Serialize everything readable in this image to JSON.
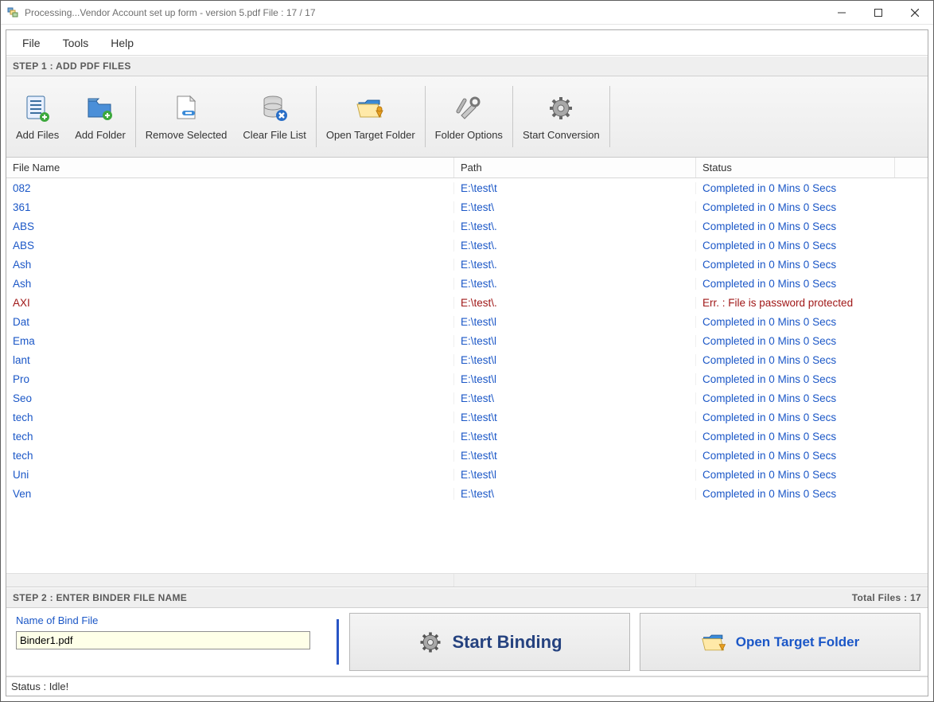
{
  "window": {
    "title": "Processing...Vendor Account set up form - version 5.pdf File : 17 / 17"
  },
  "menu": {
    "file": "File",
    "tools": "Tools",
    "help": "Help"
  },
  "step1": {
    "header": "STEP 1 : ADD PDF FILES"
  },
  "toolbar": {
    "add_files": "Add Files",
    "add_folder": "Add Folder",
    "remove_selected": "Remove Selected",
    "clear_list": "Clear File List",
    "open_target": "Open Target Folder",
    "folder_options": "Folder Options",
    "start_conversion": "Start Conversion"
  },
  "grid": {
    "headers": {
      "name": "File Name",
      "path": "Path",
      "status": "Status"
    },
    "rows": [
      {
        "name": "082",
        "path": "E:\\test\\t",
        "status": "Completed in 0 Mins 0 Secs",
        "err": false
      },
      {
        "name": "361",
        "path": "E:\\test\\",
        "status": "Completed in 0 Mins 0 Secs",
        "err": false
      },
      {
        "name": "ABS",
        "path": "E:\\test\\.",
        "status": "Completed in 0 Mins 0 Secs",
        "err": false
      },
      {
        "name": "ABS",
        "path": "E:\\test\\.",
        "status": "Completed in 0 Mins 0 Secs",
        "err": false
      },
      {
        "name": "Ash",
        "path": "E:\\test\\.",
        "status": "Completed in 0 Mins 0 Secs",
        "err": false
      },
      {
        "name": "Ash",
        "path": "E:\\test\\.",
        "status": "Completed in 0 Mins 0 Secs",
        "err": false
      },
      {
        "name": "AXI",
        "path": "E:\\test\\.",
        "status": "Err. : File is password protected",
        "err": true
      },
      {
        "name": "Dat",
        "path": "E:\\test\\l",
        "status": "Completed in 0 Mins 0 Secs",
        "err": false
      },
      {
        "name": "Ema",
        "path": "E:\\test\\l",
        "status": "Completed in 0 Mins 0 Secs",
        "err": false
      },
      {
        "name": "lant",
        "path": "E:\\test\\l",
        "status": "Completed in 0 Mins 0 Secs",
        "err": false
      },
      {
        "name": "Pro",
        "path": "E:\\test\\l",
        "status": "Completed in 0 Mins 0 Secs",
        "err": false
      },
      {
        "name": "Seo",
        "path": "E:\\test\\",
        "status": "Completed in 0 Mins 0 Secs",
        "err": false
      },
      {
        "name": "tech",
        "path": "E:\\test\\t",
        "status": "Completed in 0 Mins 0 Secs",
        "err": false
      },
      {
        "name": "tech",
        "path": "E:\\test\\t",
        "status": "Completed in 0 Mins 0 Secs",
        "err": false
      },
      {
        "name": "tech",
        "path": "E:\\test\\t",
        "status": "Completed in 0 Mins 0 Secs",
        "err": false
      },
      {
        "name": "Uni",
        "path": "E:\\test\\l",
        "status": "Completed in 0 Mins 0 Secs",
        "err": false
      },
      {
        "name": "Ven",
        "path": "E:\\test\\",
        "status": "Completed in 0 Mins 0 Secs",
        "err": false
      }
    ]
  },
  "step2": {
    "header": "STEP 2 : ENTER BINDER FILE NAME",
    "total_files": "Total Files : 17",
    "bind_label": "Name of Bind File",
    "bind_value": "Binder1.pdf",
    "start_binding": "Start Binding",
    "open_target": "Open Target Folder"
  },
  "statusbar": {
    "text": "Status  :  Idle!"
  }
}
